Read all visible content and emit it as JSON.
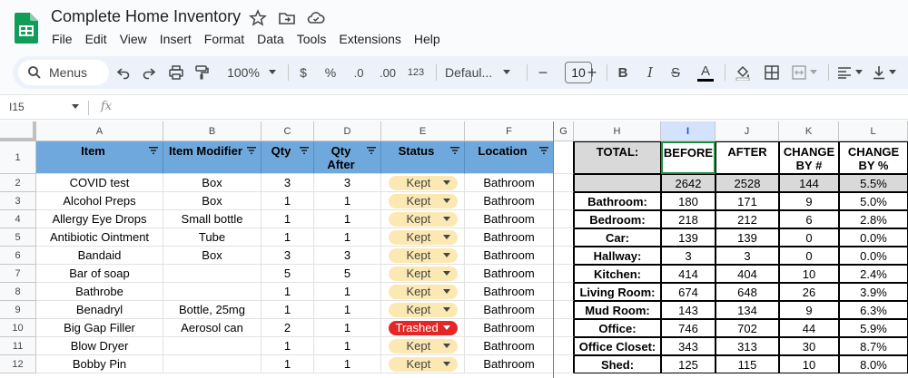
{
  "app": {
    "doc_title": "Complete Home Inventory",
    "menu": [
      "File",
      "Edit",
      "View",
      "Insert",
      "Format",
      "Data",
      "Tools",
      "Extensions",
      "Help"
    ]
  },
  "toolbar": {
    "search_label": "Menus",
    "zoom": "100%",
    "currency": "$",
    "percent": "%",
    "dec_decrease": ".0",
    "dec_increase": ".00",
    "number_format": "123",
    "font": "Defaul...",
    "font_size": "10",
    "minus": "−",
    "plus": "+",
    "bold": "B",
    "italic": "I",
    "strike": "S",
    "text_color": "A"
  },
  "formula_bar": {
    "name_box": "I15",
    "fx": "fx",
    "value": ""
  },
  "columns": [
    "A",
    "B",
    "C",
    "D",
    "E",
    "F",
    "G",
    "H",
    "I",
    "J",
    "K",
    "L"
  ],
  "active_column": "I",
  "rows": [
    "1",
    "2",
    "3",
    "4",
    "5",
    "6",
    "7",
    "8",
    "9",
    "10",
    "11",
    "12"
  ],
  "inventory_headers": {
    "item": "Item",
    "modifier": "Item Modifier",
    "qty": "Qty",
    "qty_after_1": "Qty",
    "qty_after_2": "After",
    "status": "Status",
    "location": "Location"
  },
  "inventory": [
    {
      "item": "COVID test",
      "modifier": "Box",
      "qty": "3",
      "qty_after": "3",
      "status": "Kept",
      "location": "Bathroom"
    },
    {
      "item": "Alcohol Preps",
      "modifier": "Box",
      "qty": "1",
      "qty_after": "1",
      "status": "Kept",
      "location": "Bathroom"
    },
    {
      "item": "Allergy Eye Drops",
      "modifier": "Small bottle",
      "qty": "1",
      "qty_after": "1",
      "status": "Kept",
      "location": "Bathroom"
    },
    {
      "item": "Antibiotic Ointment",
      "modifier": "Tube",
      "qty": "1",
      "qty_after": "1",
      "status": "Kept",
      "location": "Bathroom"
    },
    {
      "item": "Bandaid",
      "modifier": "Box",
      "qty": "3",
      "qty_after": "3",
      "status": "Kept",
      "location": "Bathroom"
    },
    {
      "item": "Bar of soap",
      "modifier": "",
      "qty": "5",
      "qty_after": "5",
      "status": "Kept",
      "location": "Bathroom"
    },
    {
      "item": "Bathrobe",
      "modifier": "",
      "qty": "1",
      "qty_after": "1",
      "status": "Kept",
      "location": "Bathroom"
    },
    {
      "item": "Benadryl",
      "modifier": "Bottle, 25mg",
      "qty": "1",
      "qty_after": "1",
      "status": "Kept",
      "location": "Bathroom"
    },
    {
      "item": "Big Gap Filler",
      "modifier": "Aerosol can",
      "qty": "2",
      "qty_after": "1",
      "status": "Trashed",
      "location": "Bathroom"
    },
    {
      "item": "Blow Dryer",
      "modifier": "",
      "qty": "1",
      "qty_after": "1",
      "status": "Kept",
      "location": "Bathroom"
    },
    {
      "item": "Bobby Pin",
      "modifier": "",
      "qty": "1",
      "qty_after": "1",
      "status": "Kept",
      "location": "Bathroom"
    }
  ],
  "summary_headers": {
    "total": "TOTAL:",
    "before": "BEFORE",
    "after": "AFTER",
    "change_num_1": "CHANGE",
    "change_num_2": "BY #",
    "change_pct_1": "CHANGE",
    "change_pct_2": "BY %"
  },
  "summary_total": {
    "before": "2642",
    "after": "2528",
    "change": "144",
    "pct": "5.5%"
  },
  "summary": [
    {
      "room": "Bathroom:",
      "before": "180",
      "after": "171",
      "change": "9",
      "pct": "5.0%"
    },
    {
      "room": "Bedroom:",
      "before": "218",
      "after": "212",
      "change": "6",
      "pct": "2.8%"
    },
    {
      "room": "Car:",
      "before": "139",
      "after": "139",
      "change": "0",
      "pct": "0.0%"
    },
    {
      "room": "Hallway:",
      "before": "3",
      "after": "3",
      "change": "0",
      "pct": "0.0%"
    },
    {
      "room": "Kitchen:",
      "before": "414",
      "after": "404",
      "change": "10",
      "pct": "2.4%"
    },
    {
      "room": "Living Room:",
      "before": "674",
      "after": "648",
      "change": "26",
      "pct": "3.9%"
    },
    {
      "room": "Mud Room:",
      "before": "143",
      "after": "134",
      "change": "9",
      "pct": "6.3%"
    },
    {
      "room": "Office:",
      "before": "746",
      "after": "702",
      "change": "44",
      "pct": "5.9%"
    },
    {
      "room": "Office Closet:",
      "before": "343",
      "after": "313",
      "change": "30",
      "pct": "8.7%"
    },
    {
      "room": "Shed:",
      "before": "125",
      "after": "115",
      "change": "10",
      "pct": "8.0%"
    }
  ],
  "colors": {
    "header_blue": "#6fa8dc",
    "kept_chip": "#fce8b2",
    "trashed_chip": "#e52626",
    "summary_gray": "#d9d9d9",
    "sheets_green": "#0f9d58"
  }
}
